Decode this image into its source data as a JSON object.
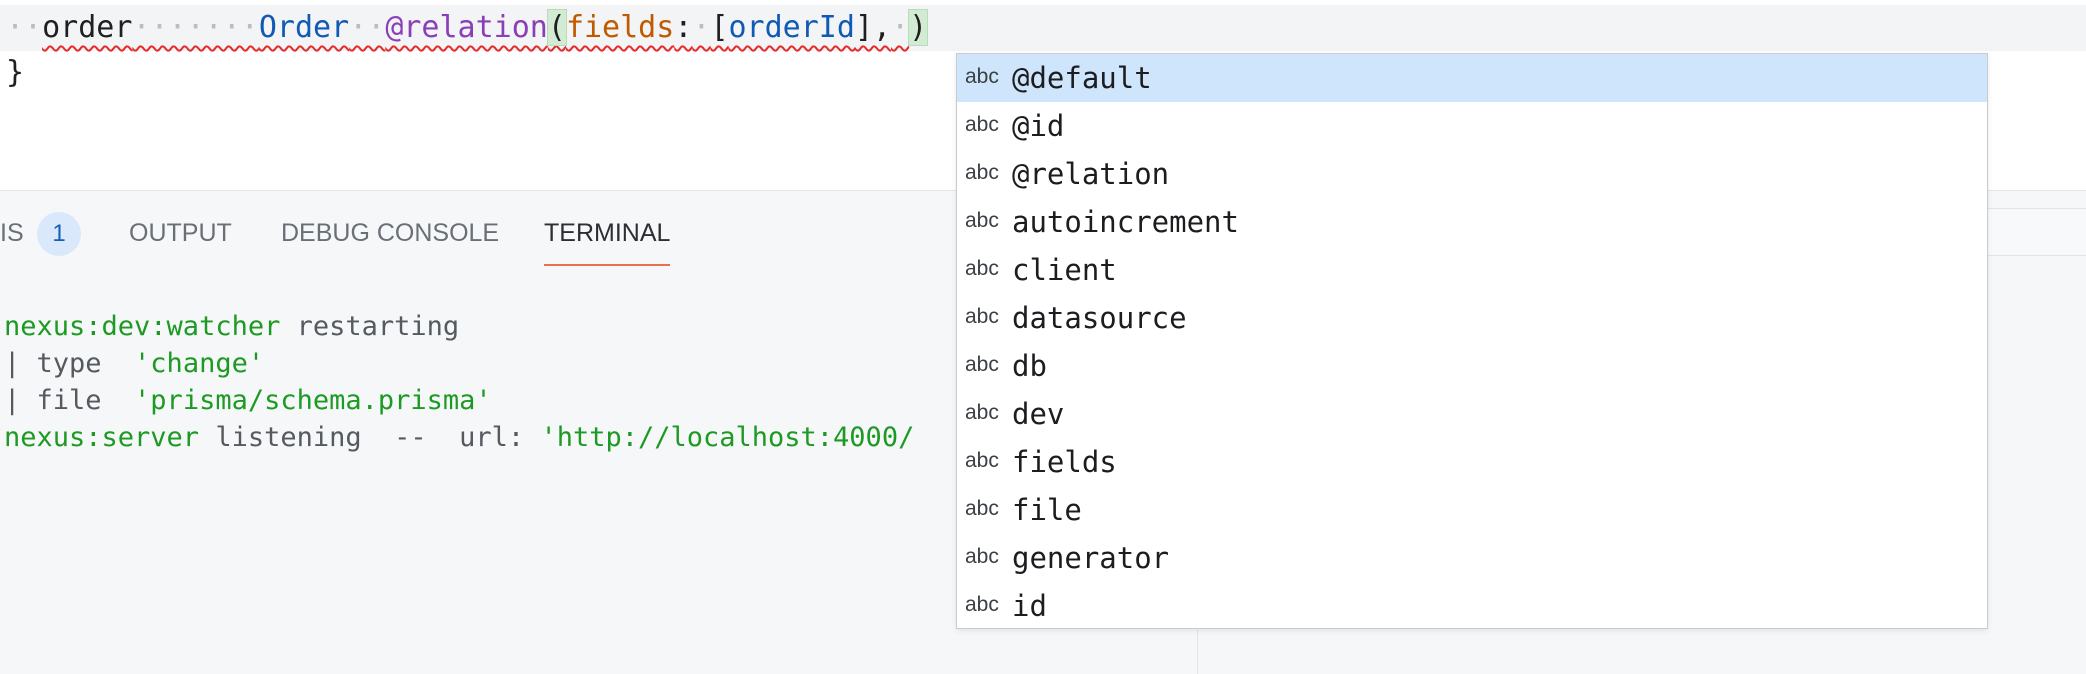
{
  "editor": {
    "line1": {
      "indent_dots": "··",
      "field_name": "order",
      "gap_dots": "·······",
      "field_type": "Order",
      "gap_dots2": "··",
      "attribute": "@relation",
      "open_paren": "(",
      "arg_key": "fields",
      "colon": ":",
      "arg_space": "·",
      "open_bracket": "[",
      "arg_value": "orderId",
      "close_bracket_comma": "],",
      "trail_space": "·",
      "close_paren": ")"
    },
    "line2": {
      "text": "}"
    }
  },
  "panel": {
    "tabs": {
      "problems_partial": "IS",
      "problems_count": "1",
      "output": "OUTPUT",
      "debug_console": "DEBUG CONSOLE",
      "terminal": "TERMINAL"
    },
    "terminal_lines": {
      "l1_a": "nexus:dev:watcher",
      "l1_b": " restarting",
      "l2_a": "| type  ",
      "l2_b": "'change'",
      "l3_a": "| file  ",
      "l3_b": "'prisma/schema.prisma'",
      "l4_a": "nexus:server",
      "l4_b": " listening  --  url: ",
      "l4_c": "'http://localhost:4000/"
    }
  },
  "suggestions": {
    "kind_label": "abc",
    "items": [
      "@default",
      "@id",
      "@relation",
      "autoincrement",
      "client",
      "datasource",
      "db",
      "dev",
      "fields",
      "file",
      "generator",
      "id"
    ],
    "selected_index": 0
  },
  "colors": {
    "terminal_green": "#1c9a22",
    "tab_underline": "#e8714a",
    "suggest_selected": "#cfe5fb",
    "attribute_purple": "#8a3fb8",
    "key_orange": "#c05a00",
    "type_blue": "#1059b4"
  }
}
